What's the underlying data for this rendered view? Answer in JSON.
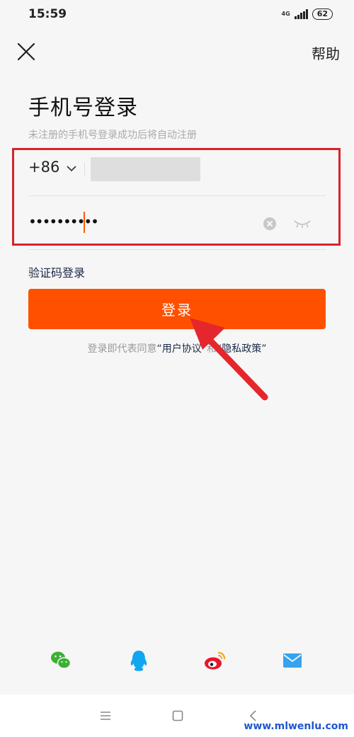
{
  "status_bar": {
    "time": "15:59",
    "network": "4G",
    "battery": "62"
  },
  "header": {
    "close_icon": "close-icon",
    "help_label": "帮助"
  },
  "login_form": {
    "title": "手机号登录",
    "subtitle": "未注册的手机号登录成功后将自动注册",
    "country_code": "+86",
    "phone_value": "",
    "password_mask": "••••••••••",
    "clear_icon": "clear-icon",
    "visibility_icon": "eye-closed-icon",
    "sms_login_label": "验证码登录",
    "login_button_label": "登录"
  },
  "agreement": {
    "prefix": "登录即代表同意",
    "user_agreement": "“用户协议”",
    "conjunction": "和",
    "privacy_policy": "“隐私政策”"
  },
  "social_login": [
    "wechat-icon",
    "qq-icon",
    "weibo-icon",
    "mail-icon"
  ],
  "nav_bar": [
    "menu-icon",
    "home-icon",
    "back-icon"
  ],
  "watermark": "www.mlwenlu.com",
  "colors": {
    "accent": "#ff5000",
    "highlight_box": "#d8232a",
    "annotation_arrow": "#e5262c",
    "link": "#1b2a47"
  }
}
